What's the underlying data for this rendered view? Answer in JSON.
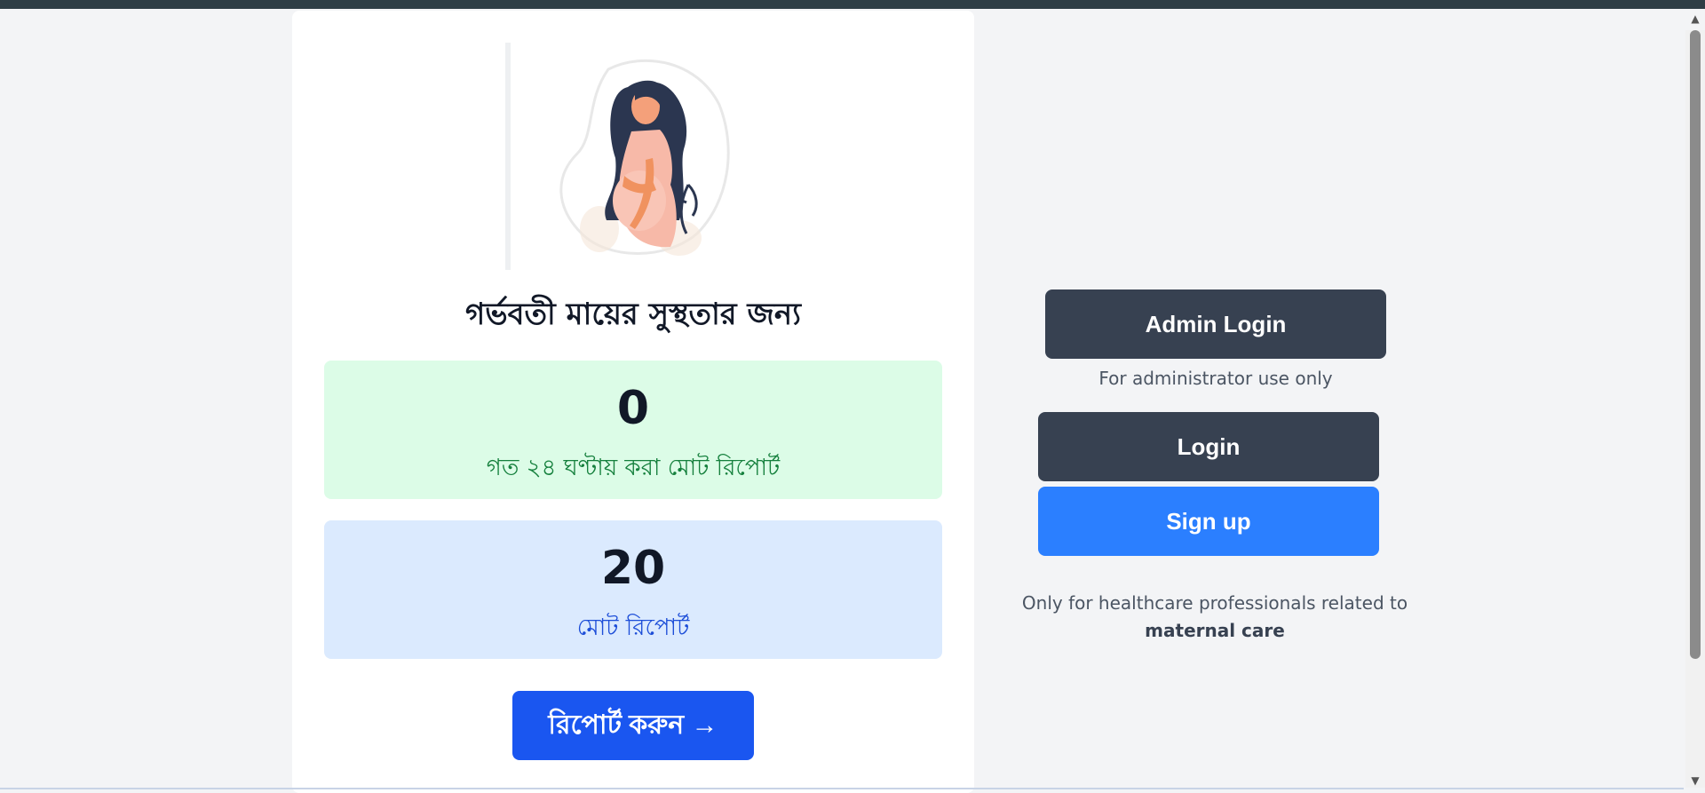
{
  "illustration": {
    "icon": "pregnant-woman-illustration"
  },
  "title": "গর্ভবতী মায়ের সুস্থতার জন্য",
  "stats": [
    {
      "value": "0",
      "label": "গত ২৪ ঘণ্টায় করা মোট রিপোর্ট",
      "color": "#dcfce7"
    },
    {
      "value": "20",
      "label": "মোট রিপোর্ট",
      "color": "#dbeafe"
    }
  ],
  "report_button": "রিপোর্ট করুন →",
  "auth": {
    "admin_login": "Admin Login",
    "admin_note": "For administrator use only",
    "login": "Login",
    "signup": "Sign up",
    "pro_note_prefix": "Only for healthcare professionals related to",
    "pro_note_bold": "maternal care"
  },
  "colors": {
    "accent_blue": "#1a56f0",
    "signup_blue": "#2b7fff",
    "dark_button": "#374151"
  }
}
